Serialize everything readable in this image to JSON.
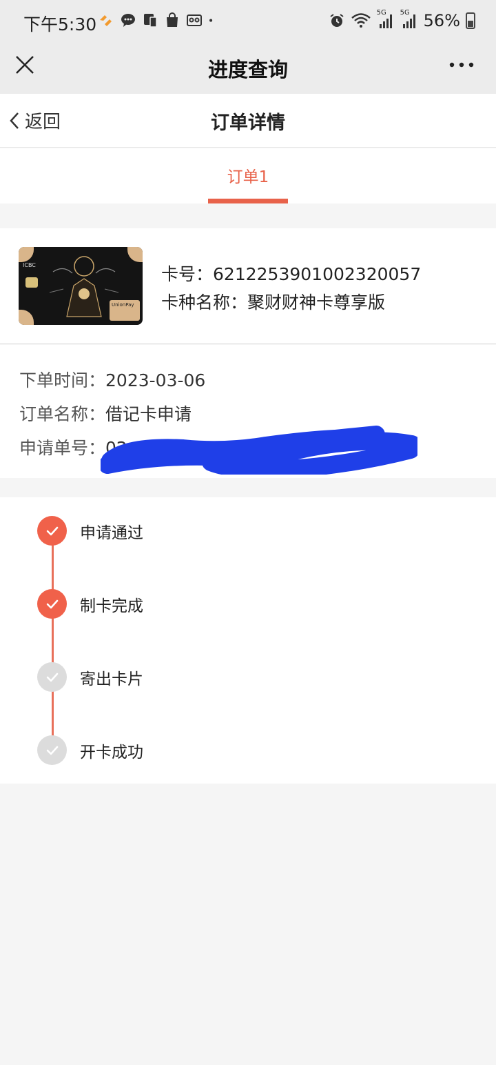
{
  "status_bar": {
    "time": "下午5:30",
    "battery": "56%",
    "network_1": "5G",
    "network_2": "5G"
  },
  "wechat_nav": {
    "title": "进度查询"
  },
  "page_header": {
    "back_label": "返回",
    "title": "订单详情"
  },
  "tabs": [
    {
      "label": "订单1",
      "active": true
    }
  ],
  "card": {
    "number_label": "卡号：",
    "number": "6212253901002320057",
    "type_label": "卡种名称：",
    "type_name": "聚财财神卡尊享版",
    "image_text": {
      "bank": "ICBC",
      "network": "UnionPay"
    }
  },
  "order": {
    "time_label": "下单时间：",
    "time": "2023-03-06",
    "name_label": "订单名称：",
    "name": "借记卡申请",
    "apply_no_label": "申请单号：",
    "apply_no_visible": "02"
  },
  "progress": {
    "steps": [
      {
        "label": "申请通过",
        "done": true
      },
      {
        "label": "制卡完成",
        "done": true
      },
      {
        "label": "寄出卡片",
        "done": false
      },
      {
        "label": "开卡成功",
        "done": false
      }
    ]
  },
  "colors": {
    "accent": "#e8624a",
    "done": "#f0614a",
    "pending": "#dcdcdc",
    "redaction": "#1f3fe8"
  }
}
